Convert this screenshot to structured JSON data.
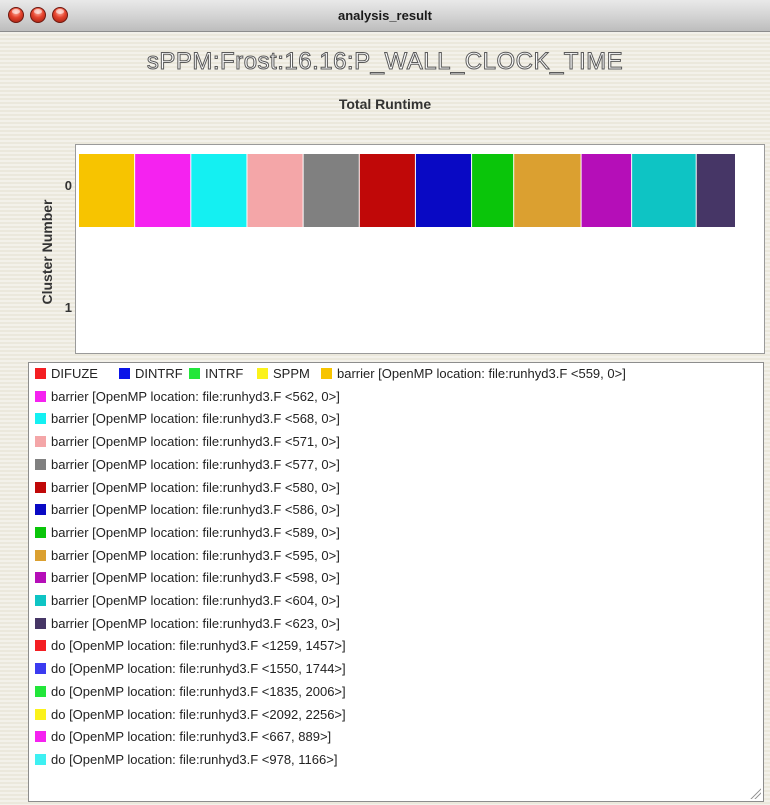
{
  "window": {
    "title": "analysis_result"
  },
  "chart_data": {
    "type": "bar",
    "orientation": "horizontal",
    "stacked": true,
    "title": "sPPM:Frost:16.16:P_WALL_CLOCK_TIME",
    "subtitle": "Total Runtime",
    "ylabel": "Cluster Number",
    "yticks": [
      "0",
      "1"
    ],
    "categories": [
      "0"
    ],
    "series": [
      {
        "color": "#f7c400",
        "values": [
          1
        ]
      },
      {
        "color": "#f522f0",
        "values": [
          1
        ]
      },
      {
        "color": "#14f0f2",
        "values": [
          1
        ]
      },
      {
        "color": "#f4a6a8",
        "values": [
          1
        ]
      },
      {
        "color": "#808080",
        "values": [
          1
        ]
      },
      {
        "color": "#c00808",
        "values": [
          1
        ]
      },
      {
        "color": "#0909c4",
        "values": [
          1
        ]
      },
      {
        "color": "#0ac50a",
        "values": [
          0.75
        ]
      },
      {
        "color": "#dba030",
        "values": [
          1.2
        ]
      },
      {
        "color": "#b50eb8",
        "values": [
          0.9
        ]
      },
      {
        "color": "#0ec4c4",
        "values": [
          1.15
        ]
      },
      {
        "color": "#463666",
        "values": [
          0.7
        ]
      }
    ],
    "legend_placement": "bottom"
  },
  "legend": {
    "items": [
      {
        "color": "#f41e22",
        "label": "DIFUZE"
      },
      {
        "color": "#0a14e8",
        "label": "DINTRF"
      },
      {
        "color": "#22e63a",
        "label": "INTRF"
      },
      {
        "color": "#fbf21a",
        "label": "SPPM"
      },
      {
        "color": "#f7c400",
        "label": "barrier [OpenMP location: file:runhyd3.F <559, 0>]"
      },
      {
        "color": "#f522f0",
        "label": "barrier [OpenMP location: file:runhyd3.F <562, 0>]"
      },
      {
        "color": "#14f0f2",
        "label": "barrier [OpenMP location: file:runhyd3.F <568, 0>]"
      },
      {
        "color": "#f4a6a8",
        "label": "barrier [OpenMP location: file:runhyd3.F <571, 0>]"
      },
      {
        "color": "#808080",
        "label": "barrier [OpenMP location: file:runhyd3.F <577, 0>]"
      },
      {
        "color": "#c00808",
        "label": "barrier [OpenMP location: file:runhyd3.F <580, 0>]"
      },
      {
        "color": "#0909c4",
        "label": "barrier [OpenMP location: file:runhyd3.F <586, 0>]"
      },
      {
        "color": "#0ac50a",
        "label": "barrier [OpenMP location: file:runhyd3.F <589, 0>]"
      },
      {
        "color": "#dba030",
        "label": "barrier [OpenMP location: file:runhyd3.F <595, 0>]"
      },
      {
        "color": "#b50eb8",
        "label": "barrier [OpenMP location: file:runhyd3.F <598, 0>]"
      },
      {
        "color": "#0ec4c4",
        "label": "barrier [OpenMP location: file:runhyd3.F <604, 0>]"
      },
      {
        "color": "#463666",
        "label": "barrier [OpenMP location: file:runhyd3.F <623, 0>]"
      },
      {
        "color": "#f41e22",
        "label": "do [OpenMP location: file:runhyd3.F <1259, 1457>]"
      },
      {
        "color": "#3b3bf0",
        "label": "do [OpenMP location: file:runhyd3.F <1550, 1744>]"
      },
      {
        "color": "#22e63a",
        "label": "do [OpenMP location: file:runhyd3.F <1835, 2006>]"
      },
      {
        "color": "#fbf21a",
        "label": "do [OpenMP location: file:runhyd3.F <2092, 2256>]"
      },
      {
        "color": "#f522f0",
        "label": "do [OpenMP location: file:runhyd3.F <667, 889>]"
      },
      {
        "color": "#3ef0f2",
        "label": "do [OpenMP location: file:runhyd3.F <978, 1166>]"
      }
    ]
  }
}
